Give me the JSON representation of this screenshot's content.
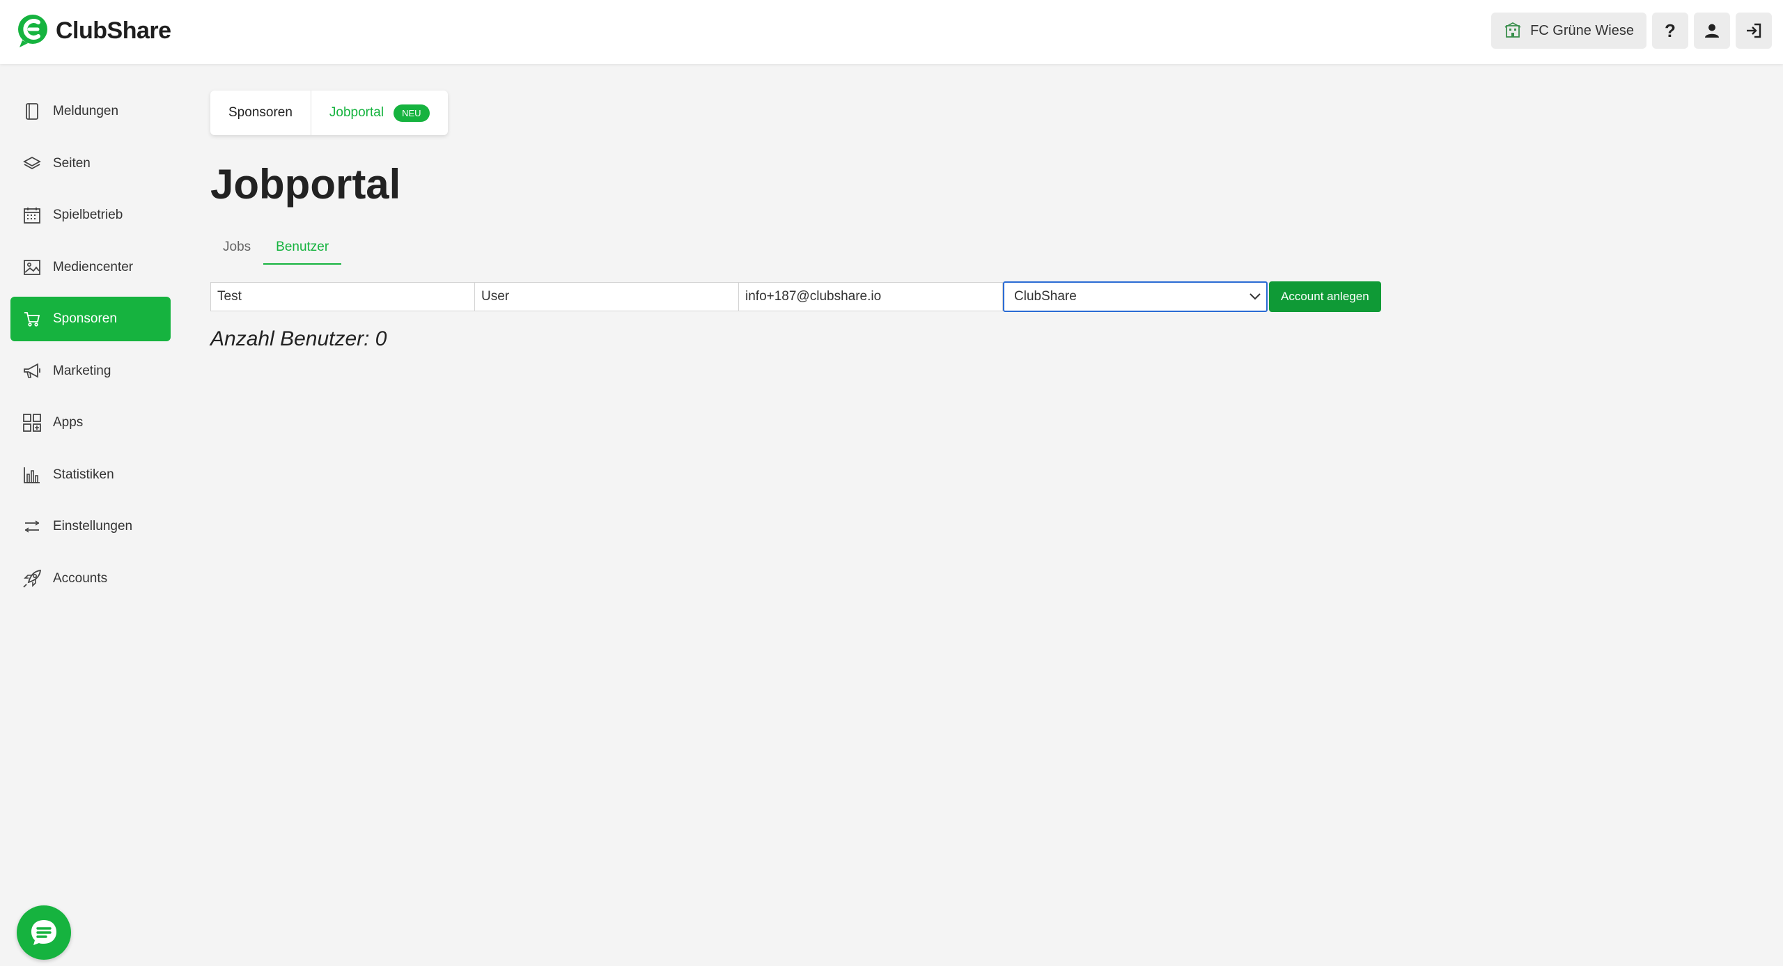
{
  "app": {
    "brand_name": "ClubShare",
    "brand_color": "#16b33f"
  },
  "topbar": {
    "club_label": "FC Grüne Wiese",
    "club_icon": "building-icon",
    "help_icon": "question-mark-icon",
    "profile_icon": "user-icon",
    "logout_icon": "logout-icon"
  },
  "sidebar": {
    "items": [
      {
        "label": "Meldungen",
        "icon": "book-icon",
        "active": false
      },
      {
        "label": "Seiten",
        "icon": "layers-icon",
        "active": false
      },
      {
        "label": "Spielbetrieb",
        "icon": "calendar-icon",
        "active": false
      },
      {
        "label": "Mediencenter",
        "icon": "image-icon",
        "active": false
      },
      {
        "label": "Sponsoren",
        "icon": "cart-icon",
        "active": true
      },
      {
        "label": "Marketing",
        "icon": "megaphone-icon",
        "active": false
      },
      {
        "label": "Apps",
        "icon": "apps-icon",
        "active": false
      },
      {
        "label": "Statistiken",
        "icon": "bar-chart-icon",
        "active": false
      },
      {
        "label": "Einstellungen",
        "icon": "sliders-icon",
        "active": false
      },
      {
        "label": "Accounts",
        "icon": "rocket-icon",
        "active": false
      }
    ]
  },
  "main": {
    "section_tabs": [
      {
        "label": "Sponsoren",
        "active": false
      },
      {
        "label": "Jobportal",
        "active": true,
        "badge": "NEU"
      }
    ],
    "title": "Jobportal",
    "subtabs": [
      {
        "label": "Jobs",
        "active": false
      },
      {
        "label": "Benutzer",
        "active": true
      }
    ],
    "form": {
      "first_name": "Test",
      "last_name": "User",
      "email": "info+187@clubshare.io",
      "company_selected": "ClubShare",
      "submit_label": "Account anlegen"
    },
    "user_count_label": "Anzahl Benutzer: 0"
  },
  "chat": {
    "icon": "chat-icon"
  }
}
